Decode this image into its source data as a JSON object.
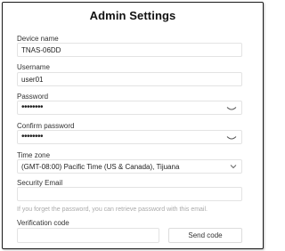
{
  "dialog": {
    "title": "Admin Settings"
  },
  "fields": {
    "device_name": {
      "label": "Device name",
      "value": "TNAS-06DD"
    },
    "username": {
      "label": "Username",
      "value": "user01"
    },
    "password": {
      "label": "Password",
      "value": "••••••••",
      "icon": "eye-closed-icon"
    },
    "confirm_password": {
      "label": "Confirm password",
      "value": "••••••••",
      "icon": "eye-closed-icon"
    },
    "time_zone": {
      "label": "Time zone",
      "value": "(GMT-08:00) Pacific Time (US & Canada), Tijuana",
      "icon": "chevron-down-icon"
    },
    "security_email": {
      "label": "Security Email",
      "value": "",
      "hint": "If you forget the password, you can retrieve password with this email."
    },
    "verification_code": {
      "label": "Verification code",
      "value": "",
      "button_label": "Send code"
    }
  },
  "colors": {
    "border": "#1a1a1a",
    "field_border": "#e3e3e3",
    "hint_text": "#aaaaaa"
  }
}
